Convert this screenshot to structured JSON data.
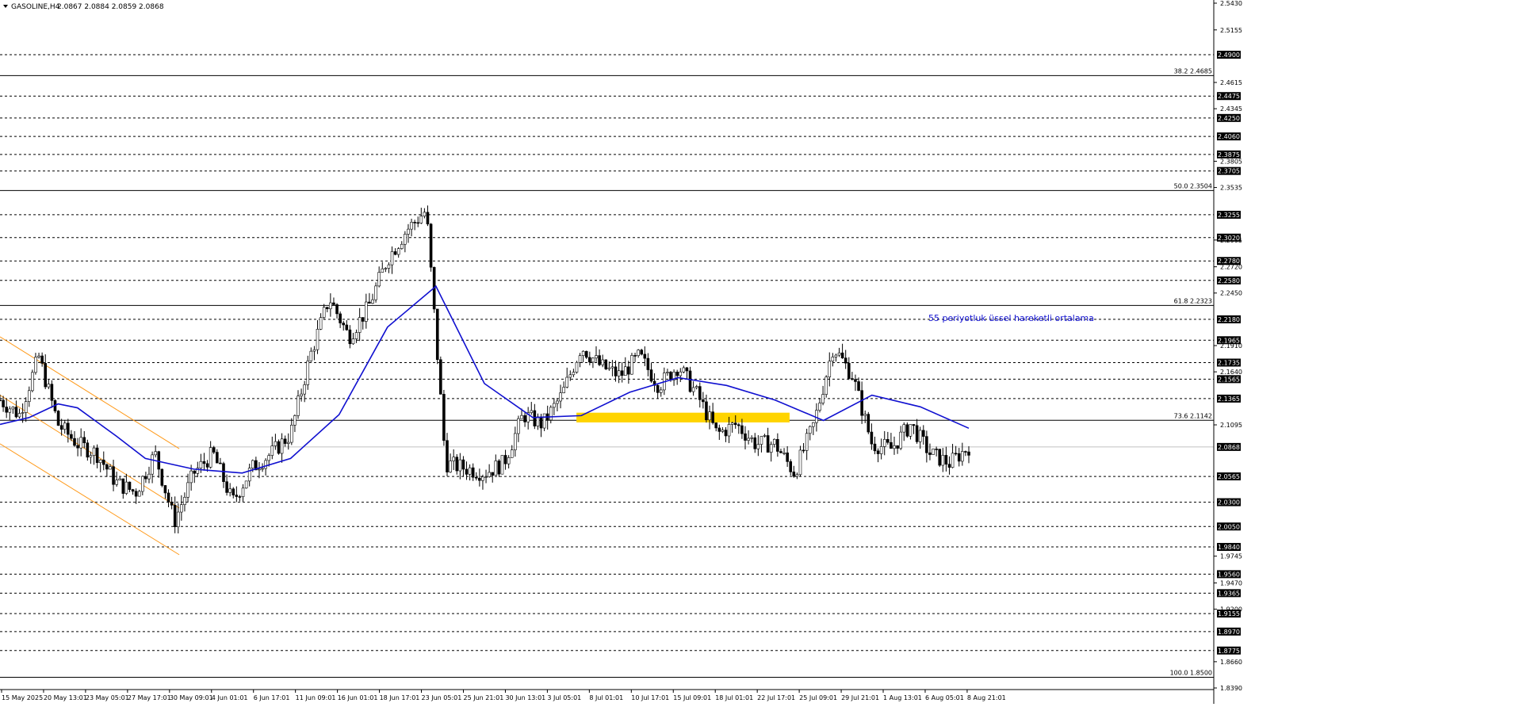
{
  "header": {
    "symbol_label": "GASOLINE,H4",
    "ohlc_label": "2.0867 2.0884 2.0859 2.0868"
  },
  "annotation": {
    "ema_label": "55 periyotluk üssel hareketli ortalama"
  },
  "colors": {
    "background": "#ffffff",
    "candle": "#000000",
    "ema": "#1010d0",
    "channel": "#ff9a1a",
    "zone": "#ffd400",
    "grid_dash": "#000000",
    "fib_line": "#000000",
    "current_price_line": "#c0c0c0",
    "label_box": "#000000",
    "label_text": "#ffffff"
  },
  "chart_data": {
    "type": "candlestick",
    "symbol": "GASOLINE",
    "timeframe": "H4",
    "ylim": [
      1.839,
      2.543
    ],
    "price_scale_ticks": [
      "2.5430",
      "2.5155",
      "2.4615",
      "2.4345",
      "2.3805",
      "2.3535",
      "2.2995",
      "2.2720",
      "2.2450",
      "2.1910",
      "2.1640",
      "2.1095",
      "1.9745",
      "1.9470",
      "1.9200",
      "1.8660",
      "1.8390"
    ],
    "boxed_levels": [
      "2.4900",
      "2.4475",
      "2.4250",
      "2.4060",
      "2.3875",
      "2.3705",
      "2.3255",
      "2.3020",
      "2.2780",
      "2.2580",
      "2.2180",
      "2.1965",
      "2.1735",
      "2.1565",
      "2.1365",
      "2.0868",
      "2.0565",
      "2.0300",
      "2.0050",
      "1.9840",
      "1.9560",
      "1.9365",
      "1.9155",
      "1.8970",
      "1.8775"
    ],
    "dashed_levels": [
      2.49,
      2.4475,
      2.425,
      2.406,
      2.3875,
      2.3705,
      2.3255,
      2.302,
      2.278,
      2.258,
      2.218,
      2.1965,
      2.1735,
      2.1565,
      2.1365,
      2.0565,
      2.03,
      2.005,
      1.984,
      1.956,
      1.9365,
      1.9155,
      1.897,
      1.8775
    ],
    "current_price": 2.0868,
    "fibonacci": [
      {
        "label": "38.2 2.4685",
        "value": 2.4685
      },
      {
        "label": "50.0 2.3504",
        "value": 2.3504
      },
      {
        "label": "61.8 2.2323",
        "value": 2.2323
      },
      {
        "label": "73.6 2.1142",
        "value": 2.1142
      },
      {
        "label": "100.0 1.8500",
        "value": 1.85
      }
    ],
    "x_labels": [
      "15 May 2025",
      "20 May 13:01",
      "23 May 05:01",
      "27 May 17:01",
      "30 May 09:01",
      "4 Jun 01:01",
      "6 Jun 17:01",
      "11 Jun 09:01",
      "16 Jun 01:01",
      "18 Jun 17:01",
      "23 Jun 05:01",
      "25 Jun 21:01",
      "30 Jun 13:01",
      "3 Jul 05:01",
      "8 Jul 01:01",
      "10 Jul 17:01",
      "15 Jul 09:01",
      "18 Jul 01:01",
      "22 Jul 17:01",
      "25 Jul 09:01",
      "29 Jul 21:01",
      "1 Aug 13:01",
      "6 Aug 05:01",
      "8 Aug 21:01"
    ],
    "ema_period": 55,
    "ema": [
      [
        0,
        2.11
      ],
      [
        0.03,
        2.117
      ],
      [
        0.06,
        2.131
      ],
      [
        0.08,
        2.127
      ],
      [
        0.12,
        2.098
      ],
      [
        0.15,
        2.075
      ],
      [
        0.2,
        2.064
      ],
      [
        0.25,
        2.06
      ],
      [
        0.3,
        2.075
      ],
      [
        0.35,
        2.12
      ],
      [
        0.4,
        2.21
      ],
      [
        0.45,
        2.252
      ],
      [
        0.5,
        2.152
      ],
      [
        0.55,
        2.117
      ],
      [
        0.6,
        2.119
      ],
      [
        0.65,
        2.143
      ],
      [
        0.7,
        2.158
      ],
      [
        0.75,
        2.15
      ],
      [
        0.8,
        2.135
      ],
      [
        0.85,
        2.114
      ],
      [
        0.9,
        2.14
      ],
      [
        0.95,
        2.128
      ],
      [
        1.0,
        2.106
      ]
    ],
    "closes": [
      2.135,
      2.12,
      2.18,
      2.11,
      2.09,
      2.08,
      2.05,
      2.04,
      2.08,
      2.01,
      2.06,
      2.08,
      2.03,
      2.065,
      2.08,
      2.1,
      2.18,
      2.24,
      2.2,
      2.23,
      2.28,
      2.31,
      2.33,
      2.07,
      2.065,
      2.06,
      2.07,
      2.12,
      2.11,
      2.14,
      2.19,
      2.17,
      2.16,
      2.18,
      2.15,
      2.17,
      2.14,
      2.1,
      2.11,
      2.09,
      2.09,
      2.06,
      2.11,
      2.19,
      2.16,
      2.09,
      2.085,
      2.11,
      2.08,
      2.07,
      2.087
    ],
    "channel": {
      "upper": [
        [
          0,
          2.2
        ],
        [
          0.185,
          2.085
        ]
      ],
      "middle": [
        [
          0,
          2.14
        ],
        [
          0.185,
          2.024
        ]
      ],
      "lower": [
        [
          0,
          2.09
        ],
        [
          0.185,
          1.976
        ]
      ]
    },
    "zone": {
      "x_from": 0.595,
      "x_to": 0.815,
      "y_top": 2.122,
      "y_bottom": 2.112
    }
  }
}
